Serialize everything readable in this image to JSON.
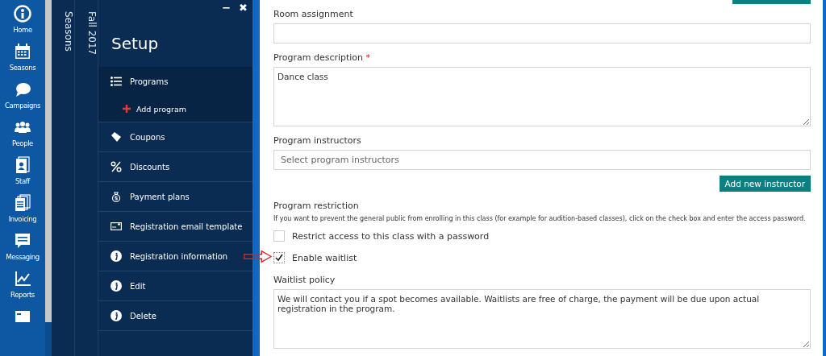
{
  "nav": [
    {
      "label": "Home"
    },
    {
      "label": "Seasons"
    },
    {
      "label": "Campaigns"
    },
    {
      "label": "People"
    },
    {
      "label": "Staff"
    },
    {
      "label": "Invoicing"
    },
    {
      "label": "Messaging"
    },
    {
      "label": "Reports"
    },
    {
      "kind": "icon-only"
    }
  ],
  "breadcrumbs": [
    "Seasons",
    "Fall 2017"
  ],
  "panel": {
    "title": "Setup",
    "minimize": "−",
    "close": "✖",
    "items": [
      {
        "label": "Programs",
        "selected": true,
        "children": [
          {
            "label": "Add program"
          }
        ]
      },
      {
        "label": "Coupons",
        "selected": false
      },
      {
        "label": "Discounts",
        "selected": false
      },
      {
        "label": "Payment plans",
        "selected": false
      },
      {
        "label": "Registration email template",
        "selected": false
      },
      {
        "label": "Registration information",
        "selected": false
      },
      {
        "label": "Edit",
        "selected": false
      },
      {
        "label": "Delete",
        "selected": false
      }
    ]
  },
  "form": [
    {
      "kind": "text",
      "label": "Room assignment"
    },
    {
      "kind": "textarea",
      "label": "Program description",
      "required_mark": "*",
      "value": "Dance class"
    },
    {
      "kind": "text",
      "label": "Program instructors",
      "placeholder": "Select program instructors",
      "button": "Add new instructor"
    },
    {
      "kind": "heading",
      "label": "Program restriction",
      "help": "If you want to prevent the general public from enrolling in this class (for example for audition-based classes), click on the check box and enter the access password."
    },
    {
      "kind": "checkbox",
      "label": "Restrict access to this class with a password",
      "checked": false
    },
    {
      "kind": "checkbox",
      "label": "Enable waitlist",
      "checked": true,
      "annotated": true
    },
    {
      "kind": "textarea",
      "label": "Waitlist policy",
      "value": "We will contact you if a spot becomes available. Waitlists are free of charge, the payment will be due upon actual registration in the program."
    }
  ]
}
